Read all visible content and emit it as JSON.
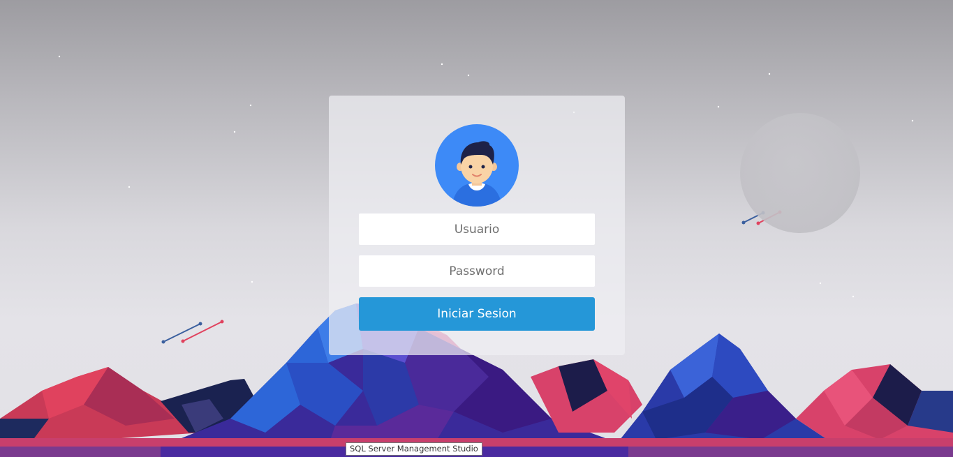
{
  "login": {
    "username_placeholder": "Usuario",
    "password_placeholder": "Password",
    "submit_label": "Iniciar Sesion"
  },
  "tooltip": {
    "text": "SQL Server Management Studio"
  },
  "colors": {
    "button": "#2597d8",
    "avatar_bg": "#3d8af7",
    "mountain_red": "#e0425e",
    "mountain_blue": "#2a4fc4",
    "mountain_purple": "#5a2a9a"
  },
  "icons": {
    "avatar": "user-avatar-icon",
    "stars": "star-icon",
    "shooting_stars": "shooting-star-icon",
    "moon": "moon-icon"
  }
}
